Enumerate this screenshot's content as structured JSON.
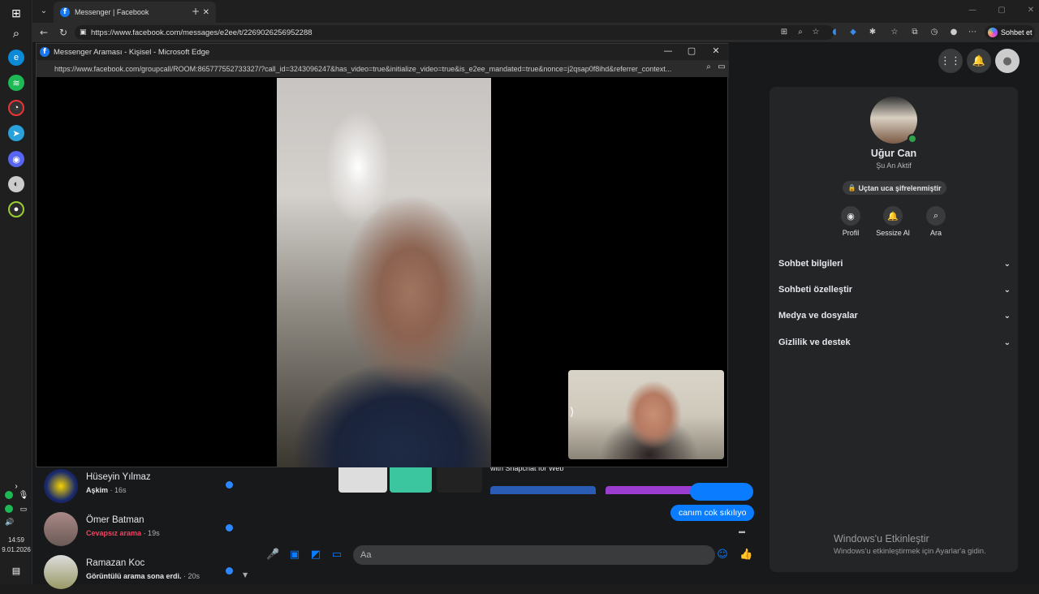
{
  "browser": {
    "tab_title": "Messenger | Facebook",
    "url": "https://www.facebook.com/messages/e2ee/t/2269026256952288",
    "copilot_label": "Sohbet et"
  },
  "popup": {
    "title": "Messenger Araması - Kişisel - Microsoft Edge",
    "url": "https://www.facebook.com/groupcall/ROOM:865777552733327/?call_id=3243096247&has_video=true&initialize_video=true&is_e2ee_mandated=true&nonce=j2qsap0f8ihd&referrer_context..."
  },
  "contact_panel": {
    "name": "Uğur Can",
    "status": "Şu An Aktif",
    "e2ee_label": "Uçtan uca şifrelenmiştir",
    "actions": [
      {
        "label": "Profil",
        "icon": "profile-icon"
      },
      {
        "label": "Sessize Al",
        "icon": "bell-icon"
      },
      {
        "label": "Ara",
        "icon": "search-icon"
      }
    ],
    "sections": [
      "Sohbet bilgileri",
      "Sohbeti özelleştir",
      "Medya ve dosyalar",
      "Gizlilik ve destek"
    ]
  },
  "chat_list": [
    {
      "name": "Hüseyin Yılmaz",
      "preview": "Aşkim",
      "time": "· 16s",
      "preview_style": "bold"
    },
    {
      "name": "Ömer Batman",
      "preview": "Cevapsız arama",
      "time": "· 19s",
      "preview_style": "red"
    },
    {
      "name": "Ramazan Koc",
      "preview": "Görüntülü arama sona erdi.",
      "time": "· 20s",
      "preview_style": "bold"
    }
  ],
  "messages": {
    "last_bubble": "canım cok sıkılıyo",
    "partial_text": "with Snapchat for Web"
  },
  "composer": {
    "placeholder": "Aa"
  },
  "taskbar": {
    "time": "14:59",
    "date": "9.01.2026"
  },
  "watermark": {
    "title": "Windows'u Etkinleştir",
    "subtitle": "Windows'u etkinleştirmek için Ayarlar'a gidin."
  }
}
